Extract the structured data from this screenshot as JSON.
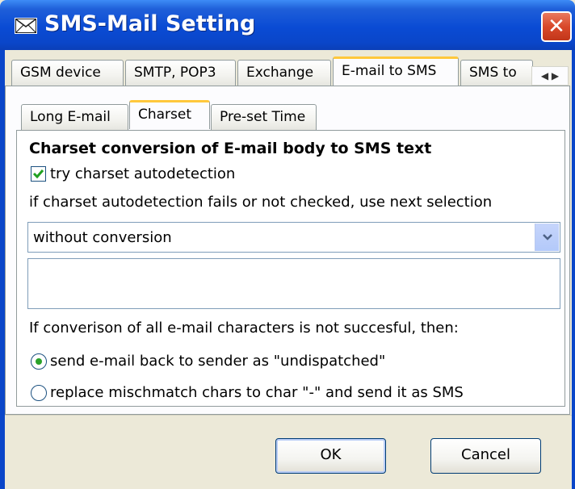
{
  "window": {
    "title": "SMS-Mail Setting",
    "close_label": "✕"
  },
  "tabs": [
    {
      "label": "GSM device",
      "active": false
    },
    {
      "label": "SMTP, POP3",
      "active": false
    },
    {
      "label": "Exchange",
      "active": false
    },
    {
      "label": "E-mail to SMS",
      "active": true
    },
    {
      "label": "SMS to",
      "active": false
    }
  ],
  "subtabs": [
    {
      "label": "Long E-mail",
      "active": false
    },
    {
      "label": "Charset",
      "active": true
    },
    {
      "label": "Pre-set Time",
      "active": false
    }
  ],
  "panel": {
    "heading": "Charset conversion of E-mail body to SMS text",
    "autodetect_label": "try charset autodetection",
    "autodetect_checked": true,
    "fallback_text": "if charset autodetection fails or not checked, use next selection",
    "charset_value": "without conversion",
    "textbox_value": "",
    "fail_text": "If converison of all e-mail characters is not succesful, then:",
    "options": [
      {
        "label": "send e-mail back to sender as \"undispatched\"",
        "selected": true
      },
      {
        "label": "replace mischmatch chars to char \"-\" and send it as SMS",
        "selected": false
      }
    ]
  },
  "buttons": {
    "ok": "OK",
    "cancel": "Cancel"
  },
  "colors": {
    "titlebar": "#0a46c9",
    "close": "#d9492a",
    "active_tab_accent": "#ffc83c",
    "radio_dot": "#2aa22a",
    "check": "#21a121"
  }
}
